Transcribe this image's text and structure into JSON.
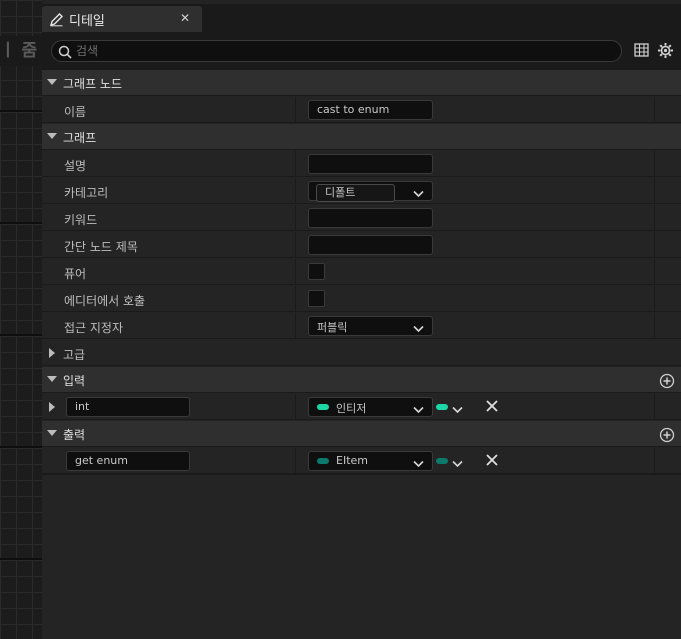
{
  "graph": {
    "title": "ㅣ 줌"
  },
  "tab": {
    "label": "디테일",
    "icon": "pencil-icon",
    "close": "✕"
  },
  "search": {
    "placeholder": "검색",
    "value": ""
  },
  "sections": {
    "graph_node": {
      "label": "그래프 노드",
      "name_label": "이름",
      "name_value": "cast to enum"
    },
    "graph": {
      "label": "그래프",
      "description_label": "설명",
      "description_value": "",
      "category_label": "카테고리",
      "category_value": "디폴트",
      "keywords_label": "키워드",
      "keywords_value": "",
      "compact_title_label": "간단 노드 제목",
      "compact_title_value": "",
      "pure_label": "퓨어",
      "pure_checked": false,
      "call_in_editor_label": "에디터에서 호출",
      "call_in_editor_checked": false,
      "access_label": "접근 지정자",
      "access_value": "퍼블릭"
    },
    "advanced": {
      "label": "고급"
    },
    "inputs": {
      "label": "입력",
      "items": [
        {
          "name": "int",
          "type": "인티저",
          "pin_color": "#1dd8a6"
        }
      ]
    },
    "outputs": {
      "label": "출력",
      "items": [
        {
          "name": "get enum",
          "type": "EItem",
          "pin_color": "#0b7a6a"
        }
      ]
    }
  },
  "colors": {
    "accent_input": "#1dd8a6",
    "accent_output": "#0b7a6a"
  }
}
